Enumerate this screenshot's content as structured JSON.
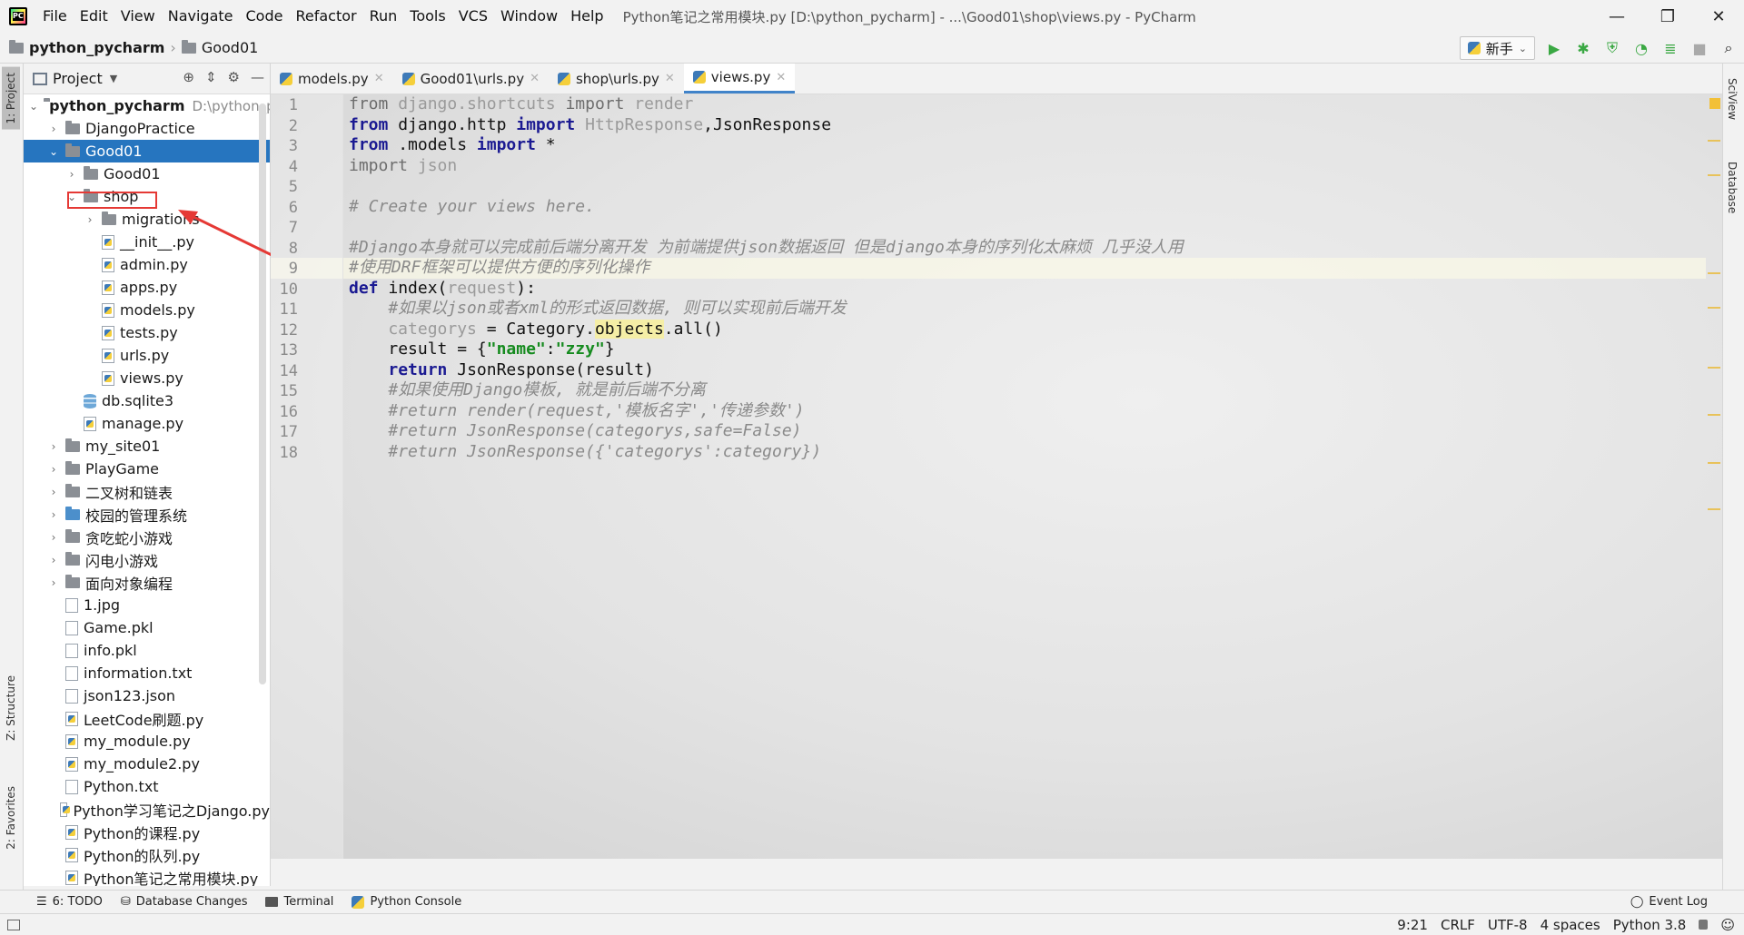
{
  "menu": {
    "items": [
      "File",
      "Edit",
      "View",
      "Navigate",
      "Code",
      "Refactor",
      "Run",
      "Tools",
      "VCS",
      "Window",
      "Help"
    ],
    "window_title": "Python笔记之常用模块.py [D:\\python_pycharm] - ...\\Good01\\shop\\views.py - PyCharm"
  },
  "window_controls": {
    "minimize": "—",
    "maximize": "❐",
    "close": "✕"
  },
  "breadcrumb": {
    "project": "python_pycharm",
    "folder": "Good01"
  },
  "toolbar": {
    "run_config": "新手"
  },
  "left_strip": {
    "project_tab": "1: Project",
    "structure_tab": "Z: Structure",
    "favorites_tab": "2: Favorites"
  },
  "right_strip": {
    "sciview_tab": "SciView",
    "database_tab": "Database"
  },
  "project_panel": {
    "title": "Project",
    "root_name": "python_pycharm",
    "root_path": "D:\\python_p",
    "tree": [
      {
        "name": "DjangoPractice",
        "depth": 1,
        "icon": "folder",
        "chev": "›"
      },
      {
        "name": "Good01",
        "depth": 1,
        "icon": "folder",
        "chev": "⌄",
        "selected": true
      },
      {
        "name": "Good01",
        "depth": 2,
        "icon": "folder",
        "chev": "›"
      },
      {
        "name": "shop",
        "depth": 2,
        "icon": "folder",
        "chev": "⌄"
      },
      {
        "name": "migrations",
        "depth": 3,
        "icon": "folder",
        "chev": "›"
      },
      {
        "name": "__init__.py",
        "depth": 3,
        "icon": "py"
      },
      {
        "name": "admin.py",
        "depth": 3,
        "icon": "py"
      },
      {
        "name": "apps.py",
        "depth": 3,
        "icon": "py"
      },
      {
        "name": "models.py",
        "depth": 3,
        "icon": "py"
      },
      {
        "name": "tests.py",
        "depth": 3,
        "icon": "py"
      },
      {
        "name": "urls.py",
        "depth": 3,
        "icon": "py"
      },
      {
        "name": "views.py",
        "depth": 3,
        "icon": "py"
      },
      {
        "name": "db.sqlite3",
        "depth": 2,
        "icon": "db"
      },
      {
        "name": "manage.py",
        "depth": 2,
        "icon": "py"
      },
      {
        "name": "my_site01",
        "depth": 1,
        "icon": "folder",
        "chev": "›"
      },
      {
        "name": "PlayGame",
        "depth": 1,
        "icon": "folder",
        "chev": "›"
      },
      {
        "name": "二叉树和链表",
        "depth": 1,
        "icon": "folder",
        "chev": "›"
      },
      {
        "name": "校园的管理系统",
        "depth": 1,
        "icon": "folder-blue",
        "chev": "›"
      },
      {
        "name": "贪吃蛇小游戏",
        "depth": 1,
        "icon": "folder",
        "chev": "›"
      },
      {
        "name": "闪电小游戏",
        "depth": 1,
        "icon": "folder",
        "chev": "›"
      },
      {
        "name": "面向对象编程",
        "depth": 1,
        "icon": "folder",
        "chev": "›"
      },
      {
        "name": "1.jpg",
        "depth": 1,
        "icon": "file"
      },
      {
        "name": "Game.pkl",
        "depth": 1,
        "icon": "file"
      },
      {
        "name": "info.pkl",
        "depth": 1,
        "icon": "file"
      },
      {
        "name": "information.txt",
        "depth": 1,
        "icon": "file"
      },
      {
        "name": "json123.json",
        "depth": 1,
        "icon": "file"
      },
      {
        "name": "LeetCode刷题.py",
        "depth": 1,
        "icon": "py"
      },
      {
        "name": "my_module.py",
        "depth": 1,
        "icon": "py"
      },
      {
        "name": "my_module2.py",
        "depth": 1,
        "icon": "py"
      },
      {
        "name": "Python.txt",
        "depth": 1,
        "icon": "file"
      },
      {
        "name": "Python学习笔记之Django.py",
        "depth": 1,
        "icon": "py"
      },
      {
        "name": "Python的课程.py",
        "depth": 1,
        "icon": "py"
      },
      {
        "name": "Python的队列.py",
        "depth": 1,
        "icon": "py"
      },
      {
        "name": "Python笔记之常用模块.py",
        "depth": 1,
        "icon": "py"
      }
    ]
  },
  "editor_tabs": [
    {
      "label": "models.py",
      "active": false
    },
    {
      "label": "Good01\\urls.py",
      "active": false
    },
    {
      "label": "shop\\urls.py",
      "active": false
    },
    {
      "label": "views.py",
      "active": true
    }
  ],
  "code": {
    "line_numbers": [
      "1",
      "2",
      "3",
      "4",
      "5",
      "6",
      "7",
      "8",
      "9",
      "10",
      "11",
      "12",
      "13",
      "14",
      "15",
      "16",
      "17",
      "18"
    ],
    "lines": [
      [
        [
          "kw-dim",
          "from"
        ],
        [
          "dim",
          " django.shortcuts "
        ],
        [
          "kw-dim",
          "import"
        ],
        [
          "dim",
          " render"
        ]
      ],
      [
        [
          "kw",
          "from"
        ],
        [
          "",
          "",
          " django.http "
        ],
        [
          "kw",
          "import"
        ],
        [
          "dim",
          " HttpResponse"
        ],
        [
          "",
          ",JsonResponse"
        ]
      ],
      [
        [
          "kw",
          "from"
        ],
        [
          "",
          " .models "
        ],
        [
          "kw",
          "import"
        ],
        [
          "",
          " *"
        ]
      ],
      [
        [
          "kw-dim",
          "import"
        ],
        [
          "dim",
          " json"
        ]
      ],
      [],
      [
        [
          "cmt",
          "# Create your views here."
        ]
      ],
      [],
      [
        [
          "cmt",
          "#Django本身就可以完成前后端分离开发 为前端提供json数据返回 但是django本身的序列化太麻烦 几乎没人用"
        ]
      ],
      [
        [
          "cmt",
          "#使用DRF框架可以提供方便的序列化操作"
        ]
      ],
      [
        [
          "kw",
          "def"
        ],
        [
          "",
          " index("
        ],
        [
          "dim",
          "request"
        ],
        [
          "",
          "):"
        ]
      ],
      [
        [
          "cmt",
          "    #如果以json或者xml的形式返回数据, 则可以实现前后端开发"
        ]
      ],
      [
        [
          "dim",
          "    categorys"
        ],
        [
          "",
          " = Category."
        ],
        [
          "hl",
          "objects"
        ],
        [
          "",
          ".all()"
        ]
      ],
      [
        [
          "",
          " "
        ],
        [
          "",
          "   result = {"
        ],
        [
          "str",
          "\"name\""
        ],
        [
          "",
          ":"
        ],
        [
          "str",
          "\"zzy\""
        ],
        [
          "",
          "}"
        ]
      ],
      [
        [
          "",
          "    "
        ],
        [
          "kw",
          "return"
        ],
        [
          "",
          " JsonResponse(result)"
        ]
      ],
      [
        [
          "cmt",
          "    #如果使用Django模板, 就是前后端不分离"
        ]
      ],
      [
        [
          "cmt",
          "    #return render(request,'模板名字','传递参数')"
        ]
      ],
      [
        [
          "cmt",
          "    #return JsonResponse(categorys,safe=False)"
        ]
      ],
      [
        [
          "cmt",
          "    #return JsonResponse({'categorys':category})"
        ]
      ]
    ]
  },
  "bottom_tools": {
    "todo": "6: TODO",
    "db_changes": "Database Changes",
    "terminal": "Terminal",
    "python_console": "Python Console",
    "event_log": "Event Log"
  },
  "status": {
    "position": "9:21",
    "line_sep": "CRLF",
    "encoding": "UTF-8",
    "indent": "4 spaces",
    "interpreter": "Python 3.8"
  },
  "colors": {
    "selection": "#2675bf",
    "keyword": "#1b1a92",
    "string": "#168b1f",
    "comment": "#8a8a8a",
    "annotation_red": "#e53935"
  }
}
